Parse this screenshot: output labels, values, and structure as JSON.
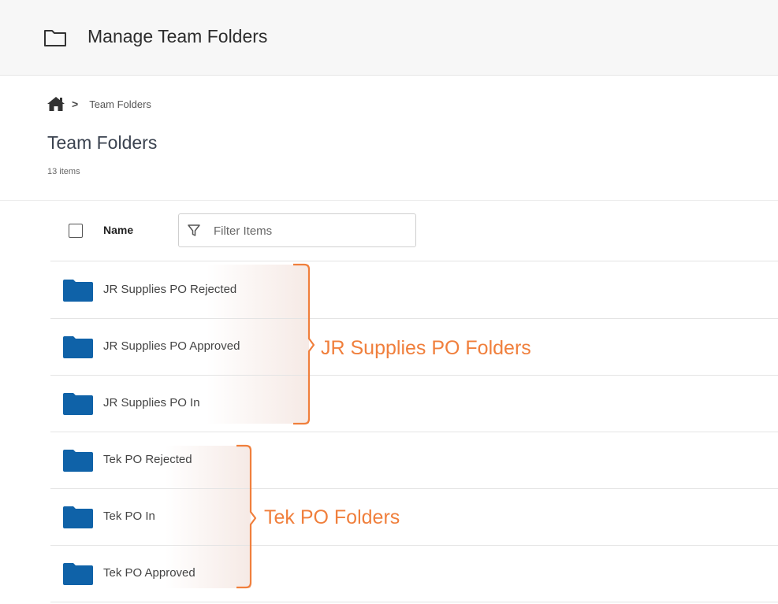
{
  "header": {
    "title": "Manage Team Folders",
    "icon": "folder-outline-icon"
  },
  "breadcrumb": {
    "home_icon": "home-icon",
    "separator": ">",
    "current": "Team Folders"
  },
  "page": {
    "title": "Team Folders",
    "item_count": "13 items"
  },
  "list": {
    "column_name": "Name",
    "filter_placeholder": "Filter Items",
    "rows": [
      {
        "name": "JR Supplies PO Rejected"
      },
      {
        "name": "JR Supplies PO Approved"
      },
      {
        "name": "JR Supplies PO In"
      },
      {
        "name": "Tek PO Rejected"
      },
      {
        "name": "Tek PO In"
      },
      {
        "name": "Tek PO Approved"
      }
    ]
  },
  "annotations": [
    {
      "label": "JR Supplies PO Folders"
    },
    {
      "label": "Tek PO Folders"
    }
  ],
  "colors": {
    "folder_blue": "#0f62a8",
    "annotation_orange": "#f07f3c"
  }
}
